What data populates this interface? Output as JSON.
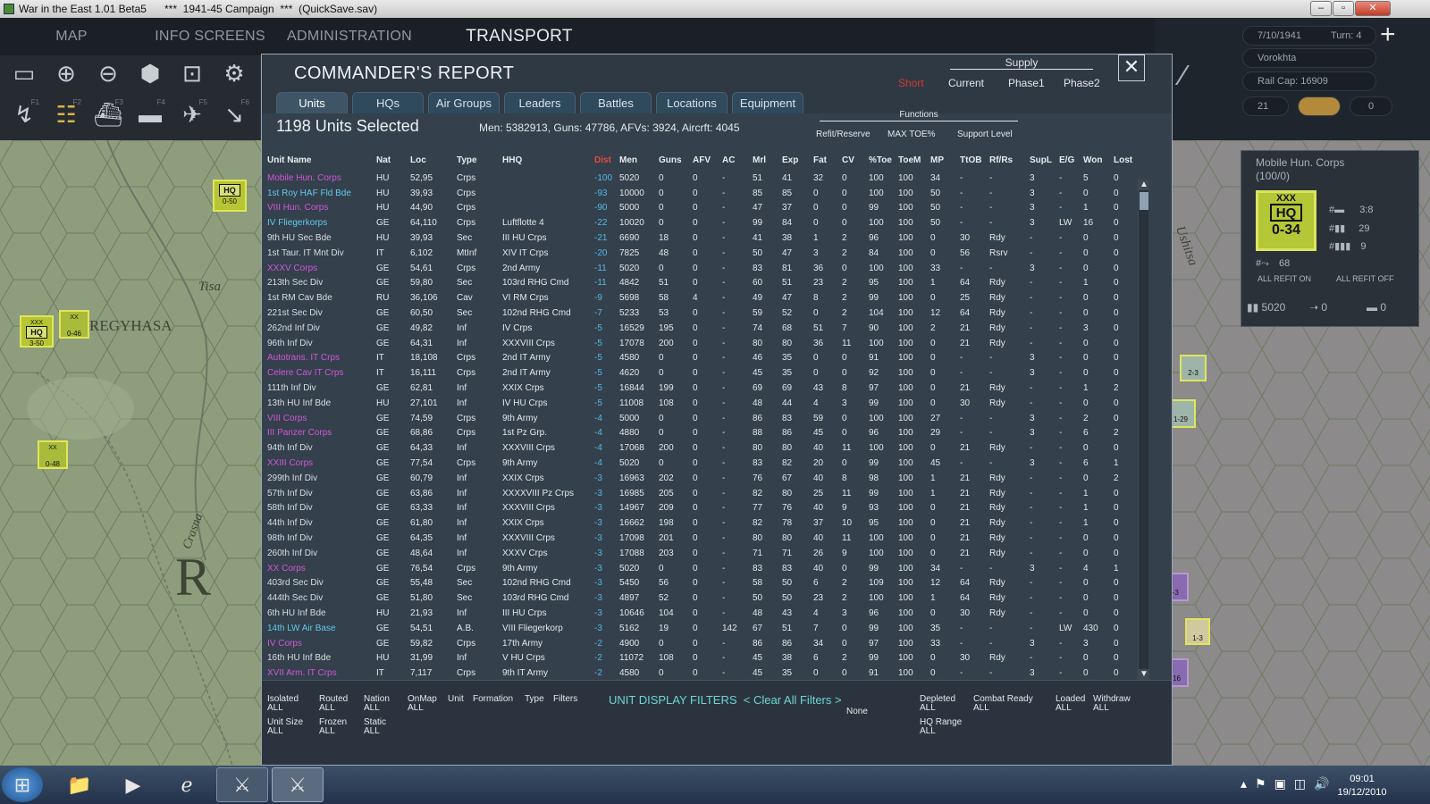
{
  "window": {
    "title": "War in the East 1.01 Beta5      ***  1941-45 Campaign  ***  (QuickSave.sav)",
    "min": "–",
    "max": "▫",
    "close": "✕"
  },
  "nav": {
    "tabs": [
      "MAP INFORMATION",
      "INFO SCREENS",
      "ADMINISTRATION",
      "TRANSPORT"
    ],
    "active": 3
  },
  "toolbar_keys": [
    "F1",
    "F2",
    "F3",
    "F4",
    "F5",
    "F6"
  ],
  "map": {
    "labels": [
      "REGYHASA",
      "Tisa",
      "Crasna",
      "R"
    ],
    "right_labels": [
      "Ushitsa"
    ],
    "counters": [
      {
        "type": "HQ",
        "top": "XXX",
        "str": "0-50"
      },
      {
        "type": "HQ",
        "top": "XXX",
        "str": "3-50"
      },
      {
        "type": "inf",
        "top": "XX",
        "str": "0-46"
      },
      {
        "type": "inf",
        "top": "XX",
        "str": "0-48"
      }
    ],
    "right_counters": [
      {
        "top": "XX",
        "str": "2-3"
      },
      {
        "top": "XX",
        "str": "1-29"
      },
      {
        "top": "XX",
        "str": "2-3"
      },
      {
        "top": "XX",
        "str": "2-16"
      },
      {
        "top": "XX",
        "str": "1-3"
      },
      {
        "top": "XX",
        "str": "16"
      }
    ]
  },
  "side": {
    "date": "7/10/1941",
    "turn": "Turn: 4",
    "location": "Vorokhta",
    "rail_cap": "Rail Cap: 16909",
    "field_a": "21",
    "field_b": "0",
    "unit_name": "Mobile Hun. Corps",
    "unit_sub": "(100/0)",
    "counter_top": "XXX",
    "counter_hq": "HQ",
    "counter_str": "0-34",
    "stat1": "3:8",
    "stat2": "29",
    "stat3": "9",
    "stat4": "68",
    "refit_on": "ALL REFIT ON",
    "refit_off": "ALL REFIT OFF",
    "men": "5020",
    "guns": "0",
    "afv": "0"
  },
  "dialog": {
    "title": "COMMANDER'S REPORT",
    "close": "✕",
    "tabs": [
      "Units",
      "HQs",
      "Air Groups",
      "Leaders",
      "Battles",
      "Locations",
      "Equipment"
    ],
    "active_tab": 0,
    "supply_label": "Supply",
    "supply_short": "Short",
    "supply_opts": [
      "Current",
      "Phase1",
      "Phase2"
    ],
    "functions_label": "Functions",
    "functions": [
      "Refit/Reserve",
      "MAX TOE%",
      "Support Level"
    ],
    "selected": "1198 Units Selected",
    "totals": "Men: 5382913, Guns: 47786, AFVs: 3924, Aircrft: 4045"
  },
  "table": {
    "columns": [
      "Unit Name",
      "Nat",
      "Loc",
      "Type",
      "HHQ",
      "Dist",
      "Men",
      "Guns",
      "AFV",
      "AC",
      "Mrl",
      "Exp",
      "Fat",
      "CV",
      "%Toe",
      "ToeM",
      "MP",
      "TtOB",
      "Rf/Rs",
      "SupL",
      "E/G",
      "Won",
      "Lost"
    ],
    "rows": [
      [
        "Mobile Hun. Corps",
        "HU",
        "52,95",
        "Crps",
        "",
        "-100",
        "5020",
        "0",
        "0",
        "-",
        "51",
        "41",
        "32",
        "0",
        "100",
        "100",
        "34",
        "-",
        "-",
        "3",
        "-",
        "5",
        "0",
        "mag"
      ],
      [
        "1st Roy HAF Fld Bde",
        "HU",
        "39,93",
        "Crps",
        "",
        "-93",
        "10000",
        "0",
        "0",
        "-",
        "85",
        "85",
        "0",
        "0",
        "100",
        "100",
        "50",
        "-",
        "-",
        "3",
        "-",
        "0",
        "0",
        "cyan"
      ],
      [
        "VIII Hun. Corps",
        "HU",
        "44,90",
        "Crps",
        "",
        "-90",
        "5000",
        "0",
        "0",
        "-",
        "47",
        "37",
        "0",
        "0",
        "99",
        "100",
        "50",
        "-",
        "-",
        "3",
        "-",
        "1",
        "0",
        "mag"
      ],
      [
        "IV Fliegerkorps",
        "GE",
        "64,110",
        "Crps",
        "Luftflotte 4",
        "-22",
        "10020",
        "0",
        "0",
        "-",
        "99",
        "84",
        "0",
        "0",
        "100",
        "100",
        "50",
        "-",
        "-",
        "3",
        "LW",
        "16",
        "0",
        "cyan"
      ],
      [
        "9th HU Sec Bde",
        "HU",
        "39,93",
        "Sec",
        "III HU Crps",
        "-21",
        "6690",
        "18",
        "0",
        "-",
        "41",
        "38",
        "1",
        "2",
        "96",
        "100",
        "0",
        "30",
        "Rdy",
        "-",
        "-",
        "0",
        "0",
        ""
      ],
      [
        "1st Taur. IT Mnt Div",
        "IT",
        "6,102",
        "MtInf",
        "XIV IT Crps",
        "-20",
        "7825",
        "48",
        "0",
        "-",
        "50",
        "47",
        "3",
        "2",
        "84",
        "100",
        "0",
        "56",
        "Rsrv",
        "-",
        "-",
        "0",
        "0",
        ""
      ],
      [
        "XXXV Corps",
        "GE",
        "54,61",
        "Crps",
        "2nd Army",
        "-11",
        "5020",
        "0",
        "0",
        "-",
        "83",
        "81",
        "36",
        "0",
        "100",
        "100",
        "33",
        "-",
        "-",
        "3",
        "-",
        "0",
        "0",
        "mag"
      ],
      [
        "213th Sec Div",
        "GE",
        "59,80",
        "Sec",
        "103rd RHG Cmd",
        "-11",
        "4842",
        "51",
        "0",
        "-",
        "60",
        "51",
        "23",
        "2",
        "95",
        "100",
        "1",
        "64",
        "Rdy",
        "-",
        "-",
        "1",
        "0",
        ""
      ],
      [
        "1st RM Cav Bde",
        "RU",
        "36,106",
        "Cav",
        "VI RM Crps",
        "-9",
        "5698",
        "58",
        "4",
        "-",
        "49",
        "47",
        "8",
        "2",
        "99",
        "100",
        "0",
        "25",
        "Rdy",
        "-",
        "-",
        "0",
        "0",
        ""
      ],
      [
        "221st Sec Div",
        "GE",
        "60,50",
        "Sec",
        "102nd RHG Cmd",
        "-7",
        "5233",
        "53",
        "0",
        "-",
        "59",
        "52",
        "0",
        "2",
        "104",
        "100",
        "12",
        "64",
        "Rdy",
        "-",
        "-",
        "0",
        "0",
        ""
      ],
      [
        "262nd Inf Div",
        "GE",
        "49,82",
        "Inf",
        "IV Crps",
        "-5",
        "16529",
        "195",
        "0",
        "-",
        "74",
        "68",
        "51",
        "7",
        "90",
        "100",
        "2",
        "21",
        "Rdy",
        "-",
        "-",
        "3",
        "0",
        ""
      ],
      [
        "96th Inf Div",
        "GE",
        "64,31",
        "Inf",
        "XXXVIII Crps",
        "-5",
        "17078",
        "200",
        "0",
        "-",
        "80",
        "80",
        "36",
        "11",
        "100",
        "100",
        "0",
        "21",
        "Rdy",
        "-",
        "-",
        "0",
        "0",
        ""
      ],
      [
        "Autotrans. IT Crps",
        "IT",
        "18,108",
        "Crps",
        "2nd IT Army",
        "-5",
        "4580",
        "0",
        "0",
        "-",
        "46",
        "35",
        "0",
        "0",
        "91",
        "100",
        "0",
        "-",
        "-",
        "3",
        "-",
        "0",
        "0",
        "mag"
      ],
      [
        "Celere Cav IT Crps",
        "IT",
        "16,111",
        "Crps",
        "2nd IT Army",
        "-5",
        "4620",
        "0",
        "0",
        "-",
        "45",
        "35",
        "0",
        "0",
        "92",
        "100",
        "0",
        "-",
        "-",
        "3",
        "-",
        "0",
        "0",
        "mag"
      ],
      [
        "111th Inf Div",
        "GE",
        "62,81",
        "Inf",
        "XXIX Crps",
        "-5",
        "16844",
        "199",
        "0",
        "-",
        "69",
        "69",
        "43",
        "8",
        "97",
        "100",
        "0",
        "21",
        "Rdy",
        "-",
        "-",
        "1",
        "2",
        ""
      ],
      [
        "13th HU Inf Bde",
        "HU",
        "27,101",
        "Inf",
        "IV HU Crps",
        "-5",
        "11008",
        "108",
        "0",
        "-",
        "48",
        "44",
        "4",
        "3",
        "99",
        "100",
        "0",
        "30",
        "Rdy",
        "-",
        "-",
        "0",
        "0",
        ""
      ],
      [
        "VIII Corps",
        "GE",
        "74,59",
        "Crps",
        "9th Army",
        "-4",
        "5000",
        "0",
        "0",
        "-",
        "86",
        "83",
        "59",
        "0",
        "100",
        "100",
        "27",
        "-",
        "-",
        "3",
        "-",
        "2",
        "0",
        "mag"
      ],
      [
        "III Panzer Corps",
        "GE",
        "68,86",
        "Crps",
        "1st Pz Grp.",
        "-4",
        "4880",
        "0",
        "0",
        "-",
        "88",
        "86",
        "45",
        "0",
        "96",
        "100",
        "29",
        "-",
        "-",
        "3",
        "-",
        "6",
        "2",
        "mag"
      ],
      [
        "94th Inf Div",
        "GE",
        "64,33",
        "Inf",
        "XXXVIII Crps",
        "-4",
        "17068",
        "200",
        "0",
        "-",
        "80",
        "80",
        "40",
        "11",
        "100",
        "100",
        "0",
        "21",
        "Rdy",
        "-",
        "-",
        "0",
        "0",
        ""
      ],
      [
        "XXIII Corps",
        "GE",
        "77,54",
        "Crps",
        "9th Army",
        "-4",
        "5020",
        "0",
        "0",
        "-",
        "83",
        "82",
        "20",
        "0",
        "99",
        "100",
        "45",
        "-",
        "-",
        "3",
        "-",
        "6",
        "1",
        "mag"
      ],
      [
        "299th Inf Div",
        "GE",
        "60,79",
        "Inf",
        "XXIX Crps",
        "-3",
        "16963",
        "202",
        "0",
        "-",
        "76",
        "67",
        "40",
        "8",
        "98",
        "100",
        "1",
        "21",
        "Rdy",
        "-",
        "-",
        "0",
        "2",
        ""
      ],
      [
        "57th Inf Div",
        "GE",
        "63,86",
        "Inf",
        "XXXXVIII Pz Crps",
        "-3",
        "16985",
        "205",
        "0",
        "-",
        "82",
        "80",
        "25",
        "11",
        "99",
        "100",
        "1",
        "21",
        "Rdy",
        "-",
        "-",
        "1",
        "0",
        ""
      ],
      [
        "58th Inf Div",
        "GE",
        "63,33",
        "Inf",
        "XXXVIII Crps",
        "-3",
        "14967",
        "209",
        "0",
        "-",
        "77",
        "76",
        "40",
        "9",
        "93",
        "100",
        "0",
        "21",
        "Rdy",
        "-",
        "-",
        "1",
        "0",
        ""
      ],
      [
        "44th Inf Div",
        "GE",
        "61,80",
        "Inf",
        "XXIX Crps",
        "-3",
        "16662",
        "198",
        "0",
        "-",
        "82",
        "78",
        "37",
        "10",
        "95",
        "100",
        "0",
        "21",
        "Rdy",
        "-",
        "-",
        "1",
        "0",
        ""
      ],
      [
        "98th Inf Div",
        "GE",
        "64,35",
        "Inf",
        "XXXVIII Crps",
        "-3",
        "17098",
        "201",
        "0",
        "-",
        "80",
        "80",
        "40",
        "11",
        "100",
        "100",
        "0",
        "21",
        "Rdy",
        "-",
        "-",
        "0",
        "0",
        ""
      ],
      [
        "260th Inf Div",
        "GE",
        "48,64",
        "Inf",
        "XXXV Crps",
        "-3",
        "17088",
        "203",
        "0",
        "-",
        "71",
        "71",
        "26",
        "9",
        "100",
        "100",
        "0",
        "21",
        "Rdy",
        "-",
        "-",
        "0",
        "0",
        ""
      ],
      [
        "XX Corps",
        "GE",
        "76,54",
        "Crps",
        "9th Army",
        "-3",
        "5020",
        "0",
        "0",
        "-",
        "83",
        "83",
        "40",
        "0",
        "99",
        "100",
        "34",
        "-",
        "-",
        "3",
        "-",
        "4",
        "1",
        "mag"
      ],
      [
        "403rd Sec Div",
        "GE",
        "55,48",
        "Sec",
        "102nd RHG Cmd",
        "-3",
        "5450",
        "56",
        "0",
        "-",
        "58",
        "50",
        "6",
        "2",
        "109",
        "100",
        "12",
        "64",
        "Rdy",
        "-",
        "-",
        "0",
        "0",
        ""
      ],
      [
        "444th Sec Div",
        "GE",
        "51,80",
        "Sec",
        "103rd RHG Cmd",
        "-3",
        "4897",
        "52",
        "0",
        "-",
        "50",
        "50",
        "23",
        "2",
        "100",
        "100",
        "1",
        "64",
        "Rdy",
        "-",
        "-",
        "0",
        "0",
        ""
      ],
      [
        "6th HU Inf Bde",
        "HU",
        "21,93",
        "Inf",
        "III HU Crps",
        "-3",
        "10646",
        "104",
        "0",
        "-",
        "48",
        "43",
        "4",
        "3",
        "96",
        "100",
        "0",
        "30",
        "Rdy",
        "-",
        "-",
        "0",
        "0",
        ""
      ],
      [
        "14th LW Air Base",
        "GE",
        "54,51",
        "A.B.",
        "VIII Fliegerkorp",
        "-3",
        "5162",
        "19",
        "0",
        "142",
        "67",
        "51",
        "7",
        "0",
        "99",
        "100",
        "35",
        "-",
        "-",
        "-",
        "LW",
        "430",
        "0",
        "cyan"
      ],
      [
        "IV Corps",
        "GE",
        "59,82",
        "Crps",
        "17th Army",
        "-2",
        "4900",
        "0",
        "0",
        "-",
        "86",
        "86",
        "34",
        "0",
        "97",
        "100",
        "33",
        "-",
        "-",
        "3",
        "-",
        "3",
        "0",
        "mag"
      ],
      [
        "16th HU Inf Bde",
        "HU",
        "31,99",
        "Inf",
        "V HU Crps",
        "-2",
        "11072",
        "108",
        "0",
        "-",
        "45",
        "38",
        "6",
        "2",
        "99",
        "100",
        "0",
        "30",
        "Rdy",
        "-",
        "-",
        "0",
        "0",
        ""
      ],
      [
        "XVII Arm. IT Crps",
        "IT",
        "7,117",
        "Crps",
        "9th IT Army",
        "-2",
        "4580",
        "0",
        "0",
        "-",
        "45",
        "35",
        "0",
        "0",
        "91",
        "100",
        "0",
        "-",
        "-",
        "3",
        "-",
        "0",
        "0",
        "mag"
      ]
    ]
  },
  "filters": {
    "title": "UNIT DISPLAY FILTERS",
    "clear": "< Clear All Filters >",
    "groups": [
      {
        "label": "Isolated",
        "value": "ALL"
      },
      {
        "label": "Routed",
        "value": "ALL"
      },
      {
        "label": "Nation",
        "value": "ALL"
      },
      {
        "label": "OnMap",
        "value": "ALL"
      },
      {
        "label": "Unit",
        "value": ""
      },
      {
        "label": "Formation",
        "value": ""
      },
      {
        "label": "Type",
        "value": ""
      },
      {
        "label": "Filters",
        "value": ""
      },
      {
        "label": "Unit Size",
        "value": "ALL"
      },
      {
        "label": "Frozen",
        "value": "ALL"
      },
      {
        "label": "Static",
        "value": "ALL"
      },
      {
        "label": "Depleted",
        "value": "ALL"
      },
      {
        "label": "Combat Ready",
        "value": "ALL"
      },
      {
        "label": "Loaded",
        "value": "ALL"
      },
      {
        "label": "Withdraw",
        "value": "ALL"
      },
      {
        "label": "HQ Range",
        "value": "ALL"
      }
    ],
    "none_label": "None"
  },
  "taskbar": {
    "time": "09:01",
    "date": "19/12/2010"
  },
  "colors": {
    "cyan_name": "#61c9e8",
    "magenta_name": "#d157d6",
    "dist": "#55b9e8",
    "accent_red": "#e04a3e",
    "filter_title": "#6dd6d6"
  }
}
